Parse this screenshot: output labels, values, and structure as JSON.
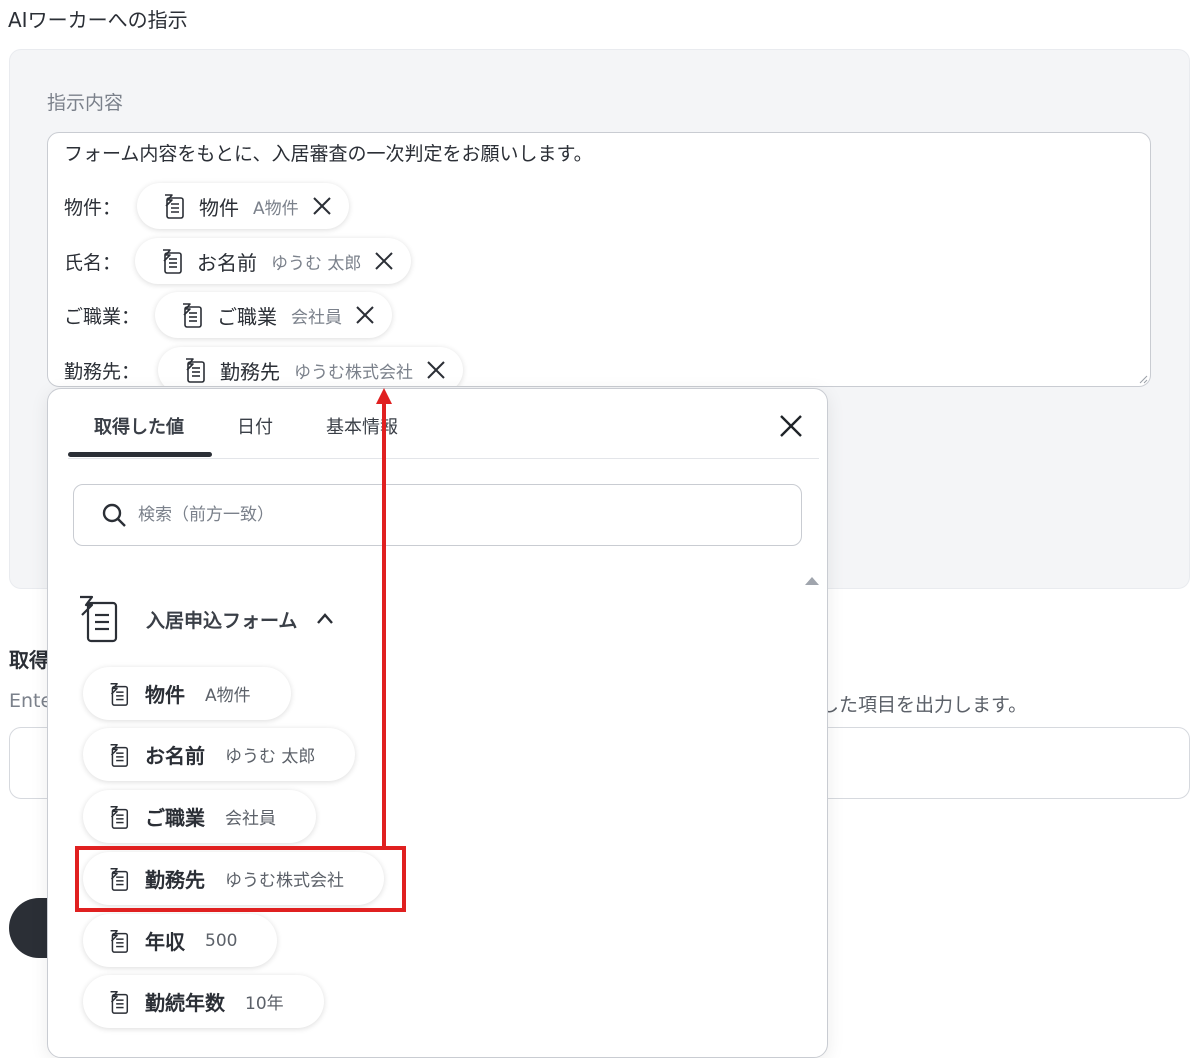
{
  "section_title": "AIワーカーへの指示",
  "instruction": {
    "label": "指示内容",
    "first_line": "フォーム内容をもとに、入居審査の一次判定をお願いします。",
    "rows": [
      {
        "label": "物件：",
        "chip_name": "物件",
        "chip_value": "A物件"
      },
      {
        "label": "氏名：",
        "chip_name": "お名前",
        "chip_value": "ゆうむ 太郎"
      },
      {
        "label": "ご職業：",
        "chip_name": "ご職業",
        "chip_value": "会社員"
      },
      {
        "label": "勤務先：",
        "chip_name": "勤務先",
        "chip_value": "ゆうむ株式会社"
      }
    ]
  },
  "background": {
    "label_2": "取得",
    "desc_left": "Ente",
    "desc_right": "した項目を出力します。"
  },
  "picker": {
    "tabs": [
      {
        "label": "取得した値",
        "active": true
      },
      {
        "label": "日付",
        "active": false
      },
      {
        "label": "基本情報",
        "active": false
      }
    ],
    "search_placeholder": "検索（前方一致）",
    "group_title": "入居申込フォーム",
    "items": [
      {
        "name": "物件",
        "value": "A物件"
      },
      {
        "name": "お名前",
        "value": "ゆうむ 太郎"
      },
      {
        "name": "ご職業",
        "value": "会社員"
      },
      {
        "name": "勤務先",
        "value": "ゆうむ株式会社"
      },
      {
        "name": "年収",
        "value": "500"
      },
      {
        "name": "勤続年数",
        "value": "10年"
      }
    ]
  },
  "colors": {
    "highlight": "#e02020",
    "text_primary": "#2b2f36",
    "text_muted": "#7b818b",
    "panel_bg": "#f4f5f7"
  }
}
